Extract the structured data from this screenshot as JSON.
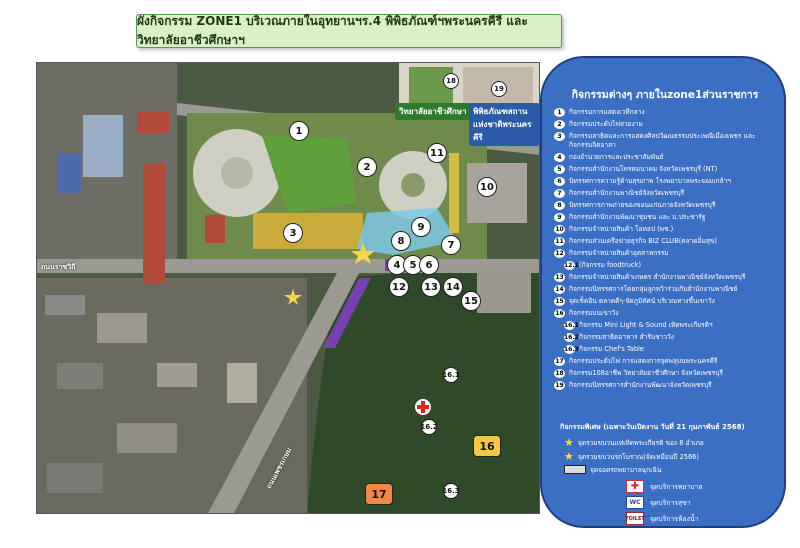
{
  "title": "ผังกิจกรรม ZONE1 บริเวณภายในอุทยานฯร.4 พิพิธภัณฑ์ฯพระนครคีรี และวิทยาลัยอาชีวศึกษาฯ",
  "map": {
    "labels": {
      "college": "วิทยาลัยอาชีวศึกษา",
      "museum": "พิพิธภัณฑสถานแห่งชาติพระนครคีรี",
      "road_top_left": "ถนนราชวิถี",
      "road_diag": "ถนนเพชรเกษม"
    },
    "badges": [
      "1",
      "2",
      "3",
      "4",
      "5",
      "6",
      "7",
      "8",
      "9",
      "10",
      "11",
      "12",
      "13",
      "14",
      "15",
      "16.1",
      "16.2",
      "16.3",
      "18",
      "19"
    ],
    "square_badges": [
      "16",
      "17"
    ]
  },
  "legend": {
    "title": "กิจกรรมต่างๆ ภายในzone1ส่วนราชการ",
    "items": [
      {
        "num": "1",
        "text": "กิจกรรมการแสดงเวทีกลาง"
      },
      {
        "num": "2",
        "text": "กิจกรรมประดับไฟสวยงาม"
      },
      {
        "num": "3",
        "text": "กิจกรรมสาธิตและการแสดงศิลปวัฒนธรรมประเพณีเมืองเพชร และกิจกรรมจิตอาสา"
      },
      {
        "num": "4",
        "text": "กองอำนวยการและประชาสัมพันธ์"
      },
      {
        "num": "5",
        "text": "กิจกรรมสำนักงานโทรคมนาคม จังหวัดเพชรบุรี (NT)"
      },
      {
        "num": "6",
        "text": "นิทรรศการความรู้ด้านสุขภาพ โรงพยาบาลพระจอมเกล้าฯ"
      },
      {
        "num": "7",
        "text": "กิจกรรมสำนักงานพาณิชย์จังหวัดเพชรบุรี"
      },
      {
        "num": "8",
        "text": "นิทรรศการภาพถ่ายของขอนแก่นภายจังหวัดเพชรบุรี"
      },
      {
        "num": "9",
        "text": "กิจกรรมสำนักงานพัฒนาชุมชน และ ม.ประชารัฐ"
      },
      {
        "num": "10",
        "text": "กิจกรรมจำหน่ายสินค้า โอทอป (พช.)"
      },
      {
        "num": "11",
        "text": "กิจกรรมส่วนเครือข่ายธุรกิจ BIZ CLUB(ตลาดอิ่มสุข)"
      },
      {
        "num": "12",
        "text": "กิจกรรมจำหน่ายสินค้าอุตสาหกรรม"
      },
      {
        "num": "12.1",
        "text": "(กิจกรรม foodtruck)",
        "sub": true
      },
      {
        "num": "13",
        "text": "กิจกรรมจำหน่ายสินค้าเกษตร สำนักงานพาณิชย์จังหวัดเพชรบุรี"
      },
      {
        "num": "14",
        "text": "กิจกรรมนิทรรศการโดยกลุ่มลูกหว้าร่วมกับสำนักงานพาณิชย์"
      },
      {
        "num": "15",
        "text": "จุดเช็คอิน ตลาดดีๆ-จัดภูมิทัศน์ บริเวณทางขึ้นเขาวัง"
      },
      {
        "num": "16",
        "text": "กิจกรรมบนเขาวัง"
      },
      {
        "num": "16.1",
        "text": "กิจกรรม Mini Light & Sound เทิดพระเกียรติฯ",
        "sub": true
      },
      {
        "num": "16.2",
        "text": "กิจกรรมสาธิตอาหาร สำรับชาววัง",
        "sub": true
      },
      {
        "num": "16.3",
        "text": "กิจกรรม Chef's Table",
        "sub": true
      },
      {
        "num": "17",
        "text": "กิจกรรมประดับไฟ การแสดงการจุดพลุบนพระนครคีรี"
      },
      {
        "num": "18",
        "text": "กิจกรรม108อาชีพ วิทยาลัยอาชีวศึกษา จังหวัดเพชรบุรี"
      },
      {
        "num": "19",
        "text": "กิจกรรมนิทรรศการสำนักงานพัฒนาจังหวัดเพชรบุรี"
      }
    ],
    "special_title": "กิจกรรมพิเศษ (เฉพาะวันเปิดงาน วันที่ 21 กุมภาพันธ์ 2568)",
    "special_items": [
      {
        "num": "1",
        "text": "จุดรวมขบวนแห่เทิดพระเกียรติ ของ 8 อำเภอ"
      },
      {
        "num": "2",
        "text": "จุดรวมขบวนรถโบราณ(จัดเหมือนปี 2566)"
      },
      {
        "num": "3",
        "text": "จุดจอดรถพยาบาลฉุกเฉิน"
      }
    ],
    "services": [
      {
        "icon": "first-aid-icon",
        "text": "จุดบริการพยาบาล"
      },
      {
        "icon": "restroom-icon",
        "text": "จุดบริการสุขา"
      },
      {
        "icon": "toilet-icon",
        "text": "จุดบริการห้องน้ำ"
      }
    ]
  }
}
